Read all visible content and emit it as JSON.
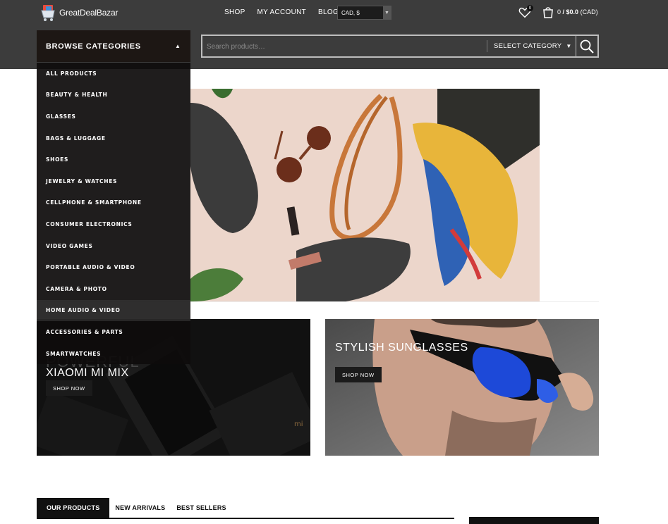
{
  "header": {
    "logo_text": "GreatDealBazar",
    "nav": [
      "SHOP",
      "MY ACCOUNT",
      "BLOG"
    ],
    "currency": "CAD, $",
    "wishlist_count": "0",
    "cart_count": "0",
    "cart_total": "$0.0",
    "cart_currency": "(CAD)"
  },
  "search": {
    "placeholder": "Search products…",
    "category_label": "SELECT CATEGORY"
  },
  "categories": {
    "title": "BROWSE CATEGORIES",
    "items": [
      "ALL PRODUCTS",
      "BEAUTY & HEALTH",
      "GLASSES",
      "BAGS & LUGGAGE",
      "SHOES",
      "JEWELRY & WATCHES",
      "CELLPHONE & SMARTPHONE",
      "CONSUMER ELECTRONICS",
      "VIDEO GAMES",
      "PORTABLE AUDIO & VIDEO",
      "CAMERA & PHOTO",
      "HOME AUDIO & VIDEO",
      "ACCESSORIES & PARTS",
      "SMARTWATCHES"
    ]
  },
  "promos": {
    "left": {
      "title_top": "POWERFUL",
      "title": "XIAOMI MI MIX",
      "button": "SHOP NOW"
    },
    "right": {
      "title": "STYLISH SUNGLASSES",
      "button": "SHOP NOW"
    }
  },
  "tabs": [
    "OUR PRODUCTS",
    "NEW ARRIVALS",
    "BEST SELLERS"
  ]
}
